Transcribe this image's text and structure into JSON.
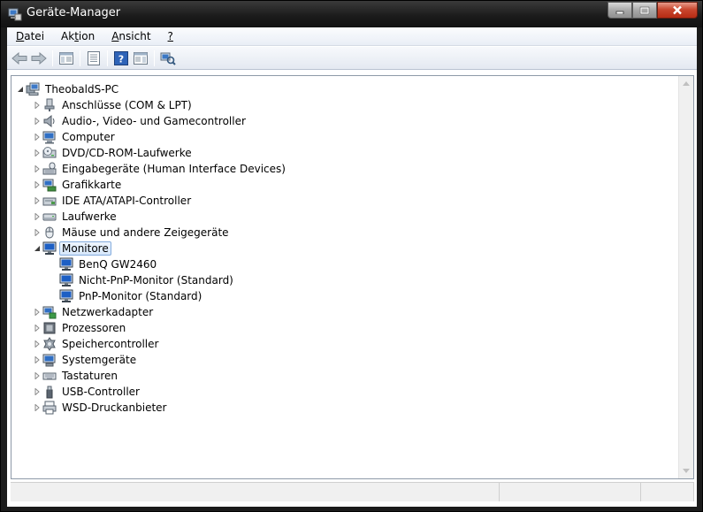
{
  "window": {
    "title": "Geräte-Manager",
    "icon": "device-manager-icon"
  },
  "menu": [
    {
      "key": "datei",
      "pre": "",
      "acc": "D",
      "post": "atei"
    },
    {
      "key": "aktion",
      "pre": "Ak",
      "acc": "t",
      "post": "ion"
    },
    {
      "key": "ansicht",
      "pre": "",
      "acc": "A",
      "post": "nsicht"
    },
    {
      "key": "hilfe",
      "pre": "",
      "acc": "?",
      "post": ""
    }
  ],
  "toolbar": {
    "icons": [
      "back-arrow-icon",
      "forward-arrow-icon",
      "show-hide-console-tree-icon",
      "properties-icon",
      "help-icon",
      "action-pane-icon",
      "scan-hardware-icon"
    ]
  },
  "tree": {
    "root": "TheobaldS-PC",
    "categories": [
      {
        "label": "Anschlüsse (COM & LPT)",
        "icon": "port-icon",
        "expanded": false
      },
      {
        "label": "Audio-, Video- und Gamecontroller",
        "icon": "speaker-icon",
        "expanded": false
      },
      {
        "label": "Computer",
        "icon": "computer-icon",
        "expanded": false
      },
      {
        "label": "DVD/CD-ROM-Laufwerke",
        "icon": "optical-drive-icon",
        "expanded": false
      },
      {
        "label": "Eingabegeräte (Human Interface Devices)",
        "icon": "hid-icon",
        "expanded": false
      },
      {
        "label": "Grafikkarte",
        "icon": "display-adapter-icon",
        "expanded": false
      },
      {
        "label": "IDE ATA/ATAPI-Controller",
        "icon": "ide-controller-icon",
        "expanded": false
      },
      {
        "label": "Laufwerke",
        "icon": "disk-drive-icon",
        "expanded": false
      },
      {
        "label": "Mäuse und andere Zeigegeräte",
        "icon": "mouse-icon",
        "expanded": false
      },
      {
        "label": "Monitore",
        "icon": "monitor-icon",
        "expanded": true,
        "selected": true,
        "children": [
          "BenQ GW2460",
          "Nicht-PnP-Monitor (Standard)",
          "PnP-Monitor (Standard)"
        ]
      },
      {
        "label": "Netzwerkadapter",
        "icon": "network-adapter-icon",
        "expanded": false
      },
      {
        "label": "Prozessoren",
        "icon": "processor-icon",
        "expanded": false
      },
      {
        "label": "Speichercontroller",
        "icon": "storage-controller-icon",
        "expanded": false
      },
      {
        "label": "Systemgeräte",
        "icon": "system-devices-icon",
        "expanded": false
      },
      {
        "label": "Tastaturen",
        "icon": "keyboard-icon",
        "expanded": false
      },
      {
        "label": "USB-Controller",
        "icon": "usb-icon",
        "expanded": false
      },
      {
        "label": "WSD-Druckanbieter",
        "icon": "printer-icon",
        "expanded": false
      }
    ]
  },
  "colors": {
    "selection_border": "#84acdd",
    "close_button": "#c9472f"
  }
}
